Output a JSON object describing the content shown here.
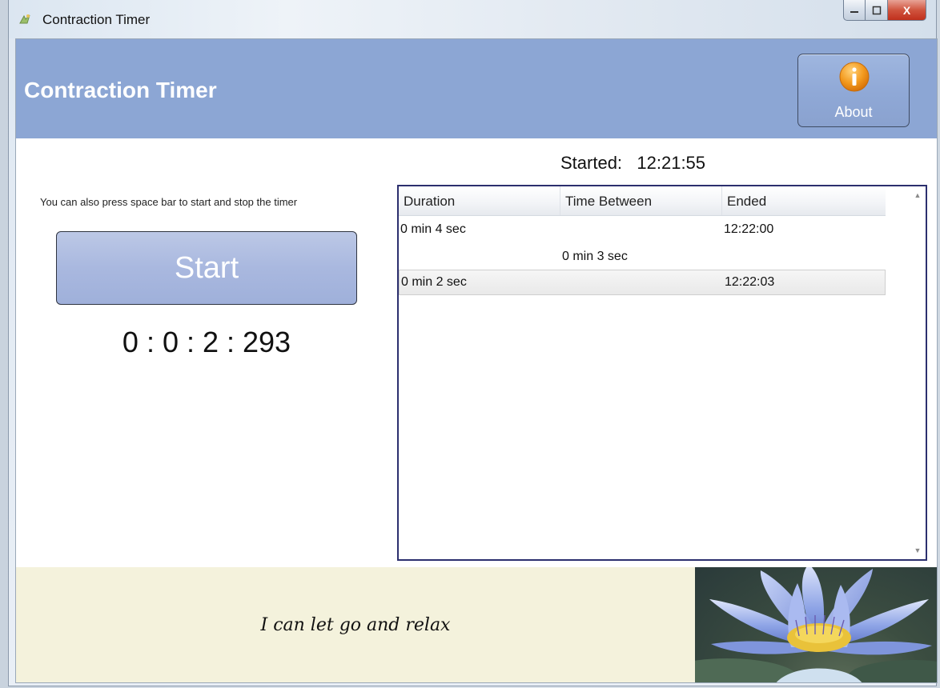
{
  "window": {
    "title": "Contraction Timer",
    "controls": {
      "minimize": "–",
      "maximize": "□",
      "close": "X"
    }
  },
  "header": {
    "title": "Contraction Timer",
    "about_label": "About",
    "band_color": "#8ca6d4"
  },
  "left": {
    "hint": "You can also press space bar to start and stop the timer",
    "start_label": "Start",
    "timer": "0 : 0 : 2 : 293"
  },
  "started": {
    "label": "Started:",
    "time": "12:21:55"
  },
  "table": {
    "columns": [
      "Duration",
      "Time Between",
      "Ended"
    ],
    "rows": [
      {
        "duration": "0 min 4 sec",
        "between": "",
        "ended": "12:22:00"
      },
      {
        "duration": "",
        "between": "0 min 3 sec",
        "ended": ""
      },
      {
        "duration": "0 min 2 sec",
        "between": "",
        "ended": "12:22:03"
      }
    ]
  },
  "footer": {
    "quote": "I can let go and relax",
    "image_icon": "lotus-flower-image"
  }
}
